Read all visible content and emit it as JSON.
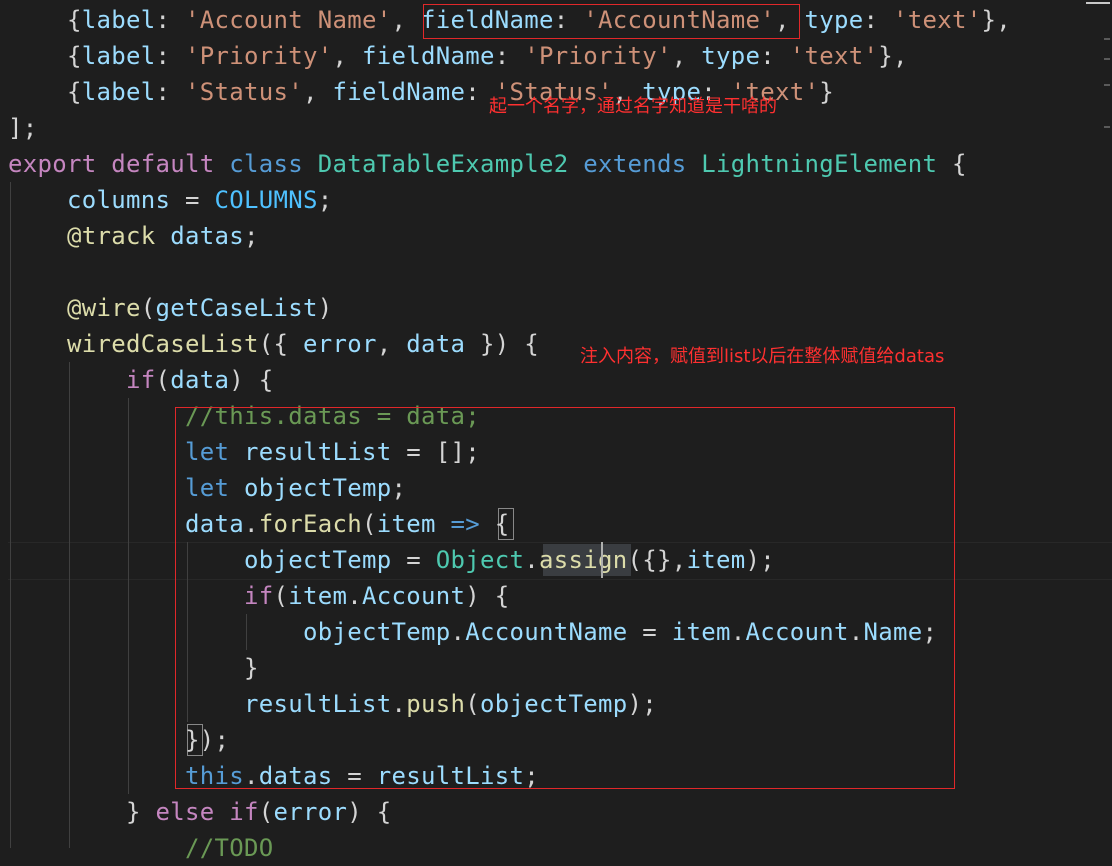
{
  "editor": {
    "theme_background": "#1e1e1e",
    "language": "javascript",
    "lines": [
      {
        "tokens": [
          [
            "punc",
            "    {"
          ],
          [
            "prop",
            "label"
          ],
          [
            "punc",
            ": "
          ],
          [
            "str",
            "'Account Name'"
          ],
          [
            "punc",
            ", "
          ],
          [
            "prop",
            "fieldName"
          ],
          [
            "punc",
            ": "
          ],
          [
            "str",
            "'AccountName'"
          ],
          [
            "punc",
            ", "
          ],
          [
            "prop",
            "type"
          ],
          [
            "punc",
            ": "
          ],
          [
            "str",
            "'text'"
          ],
          [
            "punc",
            "},"
          ]
        ]
      },
      {
        "tokens": [
          [
            "punc",
            "    {"
          ],
          [
            "prop",
            "label"
          ],
          [
            "punc",
            ": "
          ],
          [
            "str",
            "'Priority'"
          ],
          [
            "punc",
            ", "
          ],
          [
            "prop",
            "fieldName"
          ],
          [
            "punc",
            ": "
          ],
          [
            "str",
            "'Priority'"
          ],
          [
            "punc",
            ", "
          ],
          [
            "prop",
            "type"
          ],
          [
            "punc",
            ": "
          ],
          [
            "str",
            "'text'"
          ],
          [
            "punc",
            "},"
          ]
        ]
      },
      {
        "tokens": [
          [
            "punc",
            "    {"
          ],
          [
            "prop",
            "label"
          ],
          [
            "punc",
            ": "
          ],
          [
            "str",
            "'Status'"
          ],
          [
            "punc",
            ", "
          ],
          [
            "prop",
            "fieldName"
          ],
          [
            "punc",
            ": "
          ],
          [
            "str",
            "'Status'"
          ],
          [
            "punc",
            ", "
          ],
          [
            "prop",
            "type"
          ],
          [
            "punc",
            ": "
          ],
          [
            "str",
            "'text'"
          ],
          [
            "punc",
            "}"
          ]
        ]
      },
      {
        "tokens": [
          [
            "punc",
            "];"
          ]
        ]
      },
      {
        "tokens": [
          [
            "kc",
            "export"
          ],
          [
            "punc",
            " "
          ],
          [
            "kc",
            "default"
          ],
          [
            "punc",
            " "
          ],
          [
            "k",
            "class"
          ],
          [
            "punc",
            " "
          ],
          [
            "cls",
            "DataTableExample2"
          ],
          [
            "punc",
            " "
          ],
          [
            "k",
            "extends"
          ],
          [
            "punc",
            " "
          ],
          [
            "cls",
            "LightningElement"
          ],
          [
            "punc",
            " {"
          ]
        ]
      },
      {
        "tokens": [
          [
            "punc",
            "    "
          ],
          [
            "var",
            "columns"
          ],
          [
            "punc",
            " = "
          ],
          [
            "const",
            "COLUMNS"
          ],
          [
            "punc",
            ";"
          ]
        ]
      },
      {
        "tokens": [
          [
            "punc",
            "    "
          ],
          [
            "dec",
            "@track"
          ],
          [
            "punc",
            " "
          ],
          [
            "var",
            "datas"
          ],
          [
            "punc",
            ";"
          ]
        ]
      },
      {
        "tokens": []
      },
      {
        "tokens": [
          [
            "punc",
            "    "
          ],
          [
            "dec",
            "@wire"
          ],
          [
            "punc",
            "("
          ],
          [
            "var",
            "getCaseList"
          ],
          [
            "punc",
            ")"
          ]
        ]
      },
      {
        "tokens": [
          [
            "punc",
            "    "
          ],
          [
            "fn",
            "wiredCaseList"
          ],
          [
            "punc",
            "({ "
          ],
          [
            "var",
            "error"
          ],
          [
            "punc",
            ", "
          ],
          [
            "var",
            "data"
          ],
          [
            "punc",
            " }) {"
          ]
        ]
      },
      {
        "tokens": [
          [
            "punc",
            "        "
          ],
          [
            "kc",
            "if"
          ],
          [
            "punc",
            "("
          ],
          [
            "var",
            "data"
          ],
          [
            "punc",
            ") {"
          ]
        ]
      },
      {
        "tokens": [
          [
            "punc",
            "            "
          ],
          [
            "cmt",
            "//this.datas = data;"
          ]
        ]
      },
      {
        "tokens": [
          [
            "punc",
            "            "
          ],
          [
            "k",
            "let"
          ],
          [
            "punc",
            " "
          ],
          [
            "var",
            "resultList"
          ],
          [
            "punc",
            " = [];"
          ]
        ]
      },
      {
        "tokens": [
          [
            "punc",
            "            "
          ],
          [
            "k",
            "let"
          ],
          [
            "punc",
            " "
          ],
          [
            "var",
            "objectTemp"
          ],
          [
            "punc",
            ";"
          ]
        ]
      },
      {
        "tokens": [
          [
            "punc",
            "            "
          ],
          [
            "var",
            "data"
          ],
          [
            "punc",
            "."
          ],
          [
            "fn",
            "forEach"
          ],
          [
            "punc",
            "("
          ],
          [
            "var",
            "item"
          ],
          [
            "punc",
            " "
          ],
          [
            "k",
            "=>"
          ],
          [
            "punc",
            " {"
          ]
        ]
      },
      {
        "tokens": [
          [
            "punc",
            "                "
          ],
          [
            "var",
            "objectTemp"
          ],
          [
            "punc",
            " = "
          ],
          [
            "cls",
            "Object"
          ],
          [
            "punc",
            "."
          ],
          [
            "fn",
            "assign"
          ],
          [
            "punc",
            "({},"
          ],
          [
            "var",
            "item"
          ],
          [
            "punc",
            ");"
          ]
        ]
      },
      {
        "tokens": [
          [
            "punc",
            "                "
          ],
          [
            "kc",
            "if"
          ],
          [
            "punc",
            "("
          ],
          [
            "var",
            "item"
          ],
          [
            "punc",
            "."
          ],
          [
            "var",
            "Account"
          ],
          [
            "punc",
            ") {"
          ]
        ]
      },
      {
        "tokens": [
          [
            "punc",
            "                    "
          ],
          [
            "var",
            "objectTemp"
          ],
          [
            "punc",
            "."
          ],
          [
            "var",
            "AccountName"
          ],
          [
            "punc",
            " = "
          ],
          [
            "var",
            "item"
          ],
          [
            "punc",
            "."
          ],
          [
            "var",
            "Account"
          ],
          [
            "punc",
            "."
          ],
          [
            "var",
            "Name"
          ],
          [
            "punc",
            ";"
          ]
        ]
      },
      {
        "tokens": [
          [
            "punc",
            "                }"
          ]
        ]
      },
      {
        "tokens": [
          [
            "punc",
            "                "
          ],
          [
            "var",
            "resultList"
          ],
          [
            "punc",
            "."
          ],
          [
            "fn",
            "push"
          ],
          [
            "punc",
            "("
          ],
          [
            "var",
            "objectTemp"
          ],
          [
            "punc",
            ");"
          ]
        ]
      },
      {
        "tokens": [
          [
            "punc",
            "            });"
          ]
        ]
      },
      {
        "tokens": [
          [
            "punc",
            "            "
          ],
          [
            "k",
            "this"
          ],
          [
            "punc",
            "."
          ],
          [
            "var",
            "datas"
          ],
          [
            "punc",
            " = "
          ],
          [
            "var",
            "resultList"
          ],
          [
            "punc",
            ";"
          ]
        ]
      },
      {
        "tokens": [
          [
            "punc",
            "        } "
          ],
          [
            "kc",
            "else"
          ],
          [
            "punc",
            " "
          ],
          [
            "kc",
            "if"
          ],
          [
            "punc",
            "("
          ],
          [
            "var",
            "error"
          ],
          [
            "punc",
            ") {"
          ]
        ]
      },
      {
        "tokens": [
          [
            "punc",
            "            "
          ],
          [
            "cmt",
            "//TODO"
          ]
        ]
      }
    ]
  },
  "annotations": {
    "fieldname_note": "起一个名字，通过名字知道是干啥的",
    "block_note": "注入内容，赋值到list以后在整体赋值给datas"
  },
  "colors": {
    "annotation_red": "#e0282a",
    "keyword_blue": "#569cd6",
    "keyword_purple": "#c586c0",
    "class_teal": "#4ec9b0",
    "string_orange": "#ce9178",
    "comment_green": "#6a9955"
  }
}
